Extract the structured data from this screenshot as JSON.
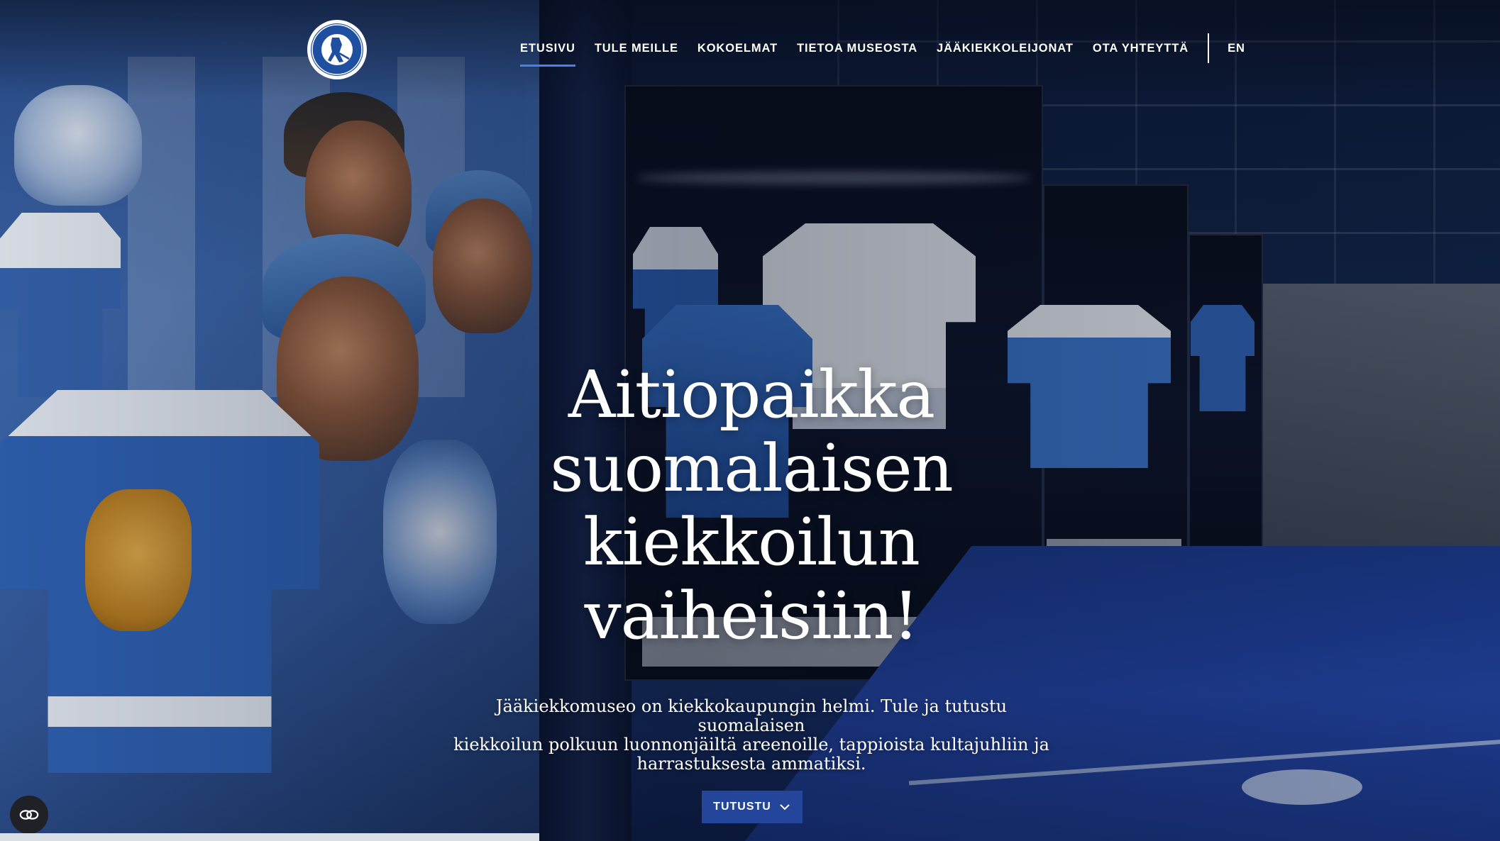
{
  "header": {
    "logo_alt": "SUOMEN JÄÄKIEKKOMUSEO HOCKEY HALL OF FAME FINLAND",
    "nav": [
      {
        "label": "ETUSIVU",
        "active": true
      },
      {
        "label": "TULE MEILLE",
        "active": false
      },
      {
        "label": "KOKOELMAT",
        "active": false
      },
      {
        "label": "TIETOA MUSEOSTA",
        "active": false
      },
      {
        "label": "JÄÄKIEKKOLEIJONAT",
        "active": false
      },
      {
        "label": "OTA YHTEYTTÄ",
        "active": false
      }
    ],
    "language": "EN"
  },
  "hero": {
    "title_lines": [
      "Aitiopaikka",
      "suomalaisen",
      "kiekkoilun",
      "vaiheisiin!"
    ],
    "subtitle_lines": [
      "Jääkiekkomuseo on kiekkokaupungin helmi. Tule ja tutustu suomalaisen",
      "kiekkoilun polkuun luonnonjäiltä areenoille, tappioista kultajuhliin ja",
      "harrastuksesta ammatiksi."
    ],
    "cta_label": "TUTUSTU",
    "cta_icon": "chevron-down-icon"
  },
  "floating": {
    "accessibility_icon": "accessibility-toggle-icon"
  },
  "colors": {
    "accent": "#4d7fe8",
    "cta_bg": "#23469a"
  }
}
